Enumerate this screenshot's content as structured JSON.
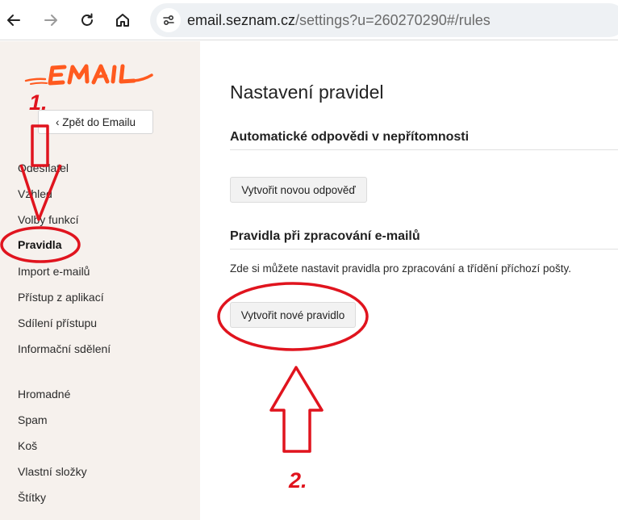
{
  "browser": {
    "url_host": "email.seznam.cz",
    "url_path": "/settings?u=260270290#/rules"
  },
  "sidebar": {
    "back_label": "‹ Zpět do Emailu",
    "items": [
      {
        "label": "Odesílatel"
      },
      {
        "label": "Vzhled"
      },
      {
        "label": "Volby funkcí"
      },
      {
        "label": "Pravidla",
        "active": true
      },
      {
        "label": "Import e-mailů"
      },
      {
        "label": "Přístup z aplikací"
      },
      {
        "label": "Sdílení přístupu"
      },
      {
        "label": "Informační sdělení"
      },
      {
        "label": "Hromadné"
      },
      {
        "label": "Spam"
      },
      {
        "label": "Koš"
      },
      {
        "label": "Vlastní složky"
      },
      {
        "label": "Štítky"
      }
    ]
  },
  "main": {
    "title": "Nastavení pravidel",
    "autoreply": {
      "heading": "Automatické odpovědi v nepřítomnosti",
      "button": "Vytvořit novou odpověď"
    },
    "rules": {
      "heading": "Pravidla při zpracování e-mailů",
      "description": "Zde si můžete nastavit pravidla pro zpracování a třídění příchozí pošty.",
      "button": "Vytvořit nové pravidlo"
    }
  },
  "annotations": {
    "step1": "1.",
    "step2": "2.",
    "color": "#e0141e"
  },
  "brand": {
    "accent": "#ff5a1f",
    "sidebar_bg": "#f6f1ed"
  }
}
